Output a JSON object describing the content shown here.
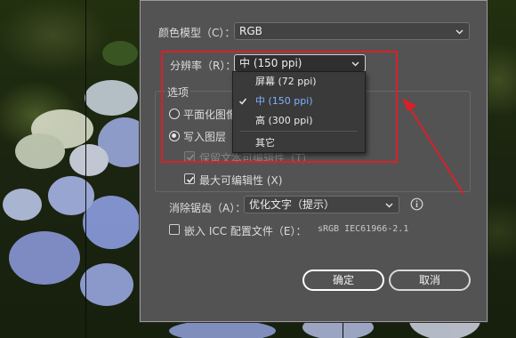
{
  "dialog": {
    "color_model": {
      "label": "颜色模型（C）：",
      "value": "RGB"
    },
    "resolution": {
      "label": "分辨率（R）：",
      "value": "中 (150 ppi)"
    },
    "options": {
      "title": "选项",
      "flatten_label": "平面化图像",
      "write_layers_label": "写入图层",
      "write_layers_selected": true,
      "keep_text_label": "保留文本可编辑性（T）",
      "keep_text_checked": true,
      "keep_text_disabled": true,
      "max_edit_label": "最大可编辑性 (X)",
      "max_edit_checked": true
    },
    "antialias": {
      "label": "消除锯齿（A）：",
      "value": "优化文字（提示）"
    },
    "icc": {
      "label": "嵌入 ICC 配置文件（E）：",
      "value": "sRGB IEC61966-2.1",
      "checked": false
    },
    "ok_label": "确定",
    "cancel_label": "取消"
  },
  "resolution_menu": {
    "items": [
      {
        "label": "屏幕 (72 ppi)",
        "selected": false
      },
      {
        "label": "中 (150 ppi)",
        "selected": true
      },
      {
        "label": "高 (300 ppi)",
        "selected": false
      },
      {
        "label": "其它",
        "selected": false
      }
    ]
  },
  "colors": {
    "dialog_bg": "#535353",
    "annotation_red": "#d8202a",
    "selected_item": "#7fb2ff"
  }
}
